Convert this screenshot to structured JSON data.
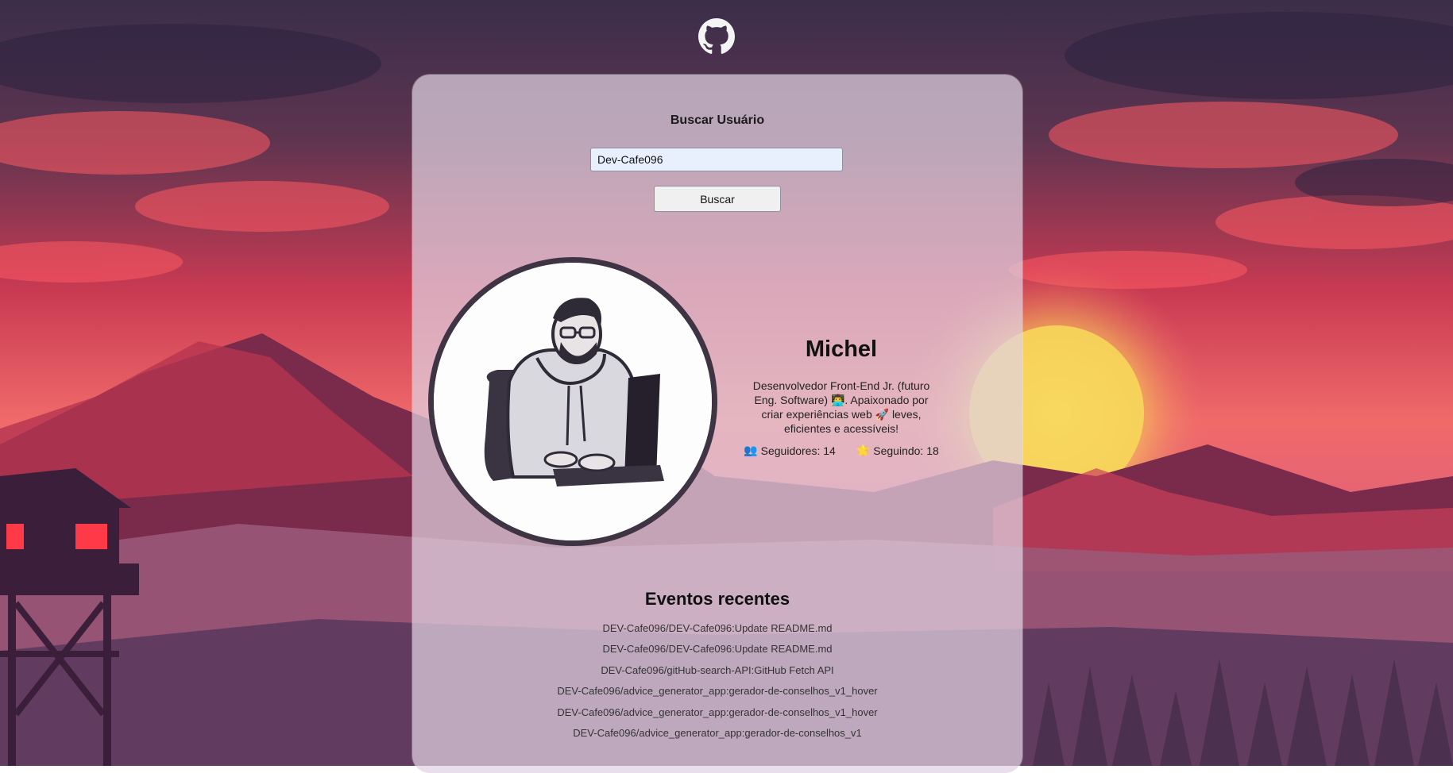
{
  "search": {
    "title": "Buscar Usuário",
    "input_value": "Dev-Cafe096",
    "button_label": "Buscar"
  },
  "profile": {
    "name": "Michel",
    "bio": "Desenvolvedor Front-End Jr. (futuro Eng. Software) 👨‍💻. Apaixonado por criar experiências web 🚀 leves, eficientes e acessíveis!",
    "followers_icon": "👥",
    "followers_text": "Seguidores: 14",
    "following_icon": "🌟",
    "following_text": "Seguindo: 18"
  },
  "events": {
    "title": "Eventos recentes",
    "items": [
      "DEV-Cafe096/DEV-Cafe096:Update README.md",
      "DEV-Cafe096/DEV-Cafe096:Update README.md",
      "DEV-Cafe096/gitHub-search-API:GitHub Fetch API",
      "DEV-Cafe096/advice_generator_app:gerador-de-conselhos_v1_hover",
      "DEV-Cafe096/advice_generator_app:gerador-de-conselhos_v1_hover",
      "DEV-Cafe096/advice_generator_app:gerador-de-conselhos_v1"
    ]
  },
  "icons": {
    "logo": "github-icon",
    "avatar": "developer-illustration"
  },
  "colors": {
    "sky_top": "#3b2e4a",
    "sky_mid": "#d8344f",
    "sun": "#f6d14a",
    "mountain": "#7a2a4a",
    "card_bg": "#e0d2e2",
    "avatar_border": "#3f3444"
  }
}
